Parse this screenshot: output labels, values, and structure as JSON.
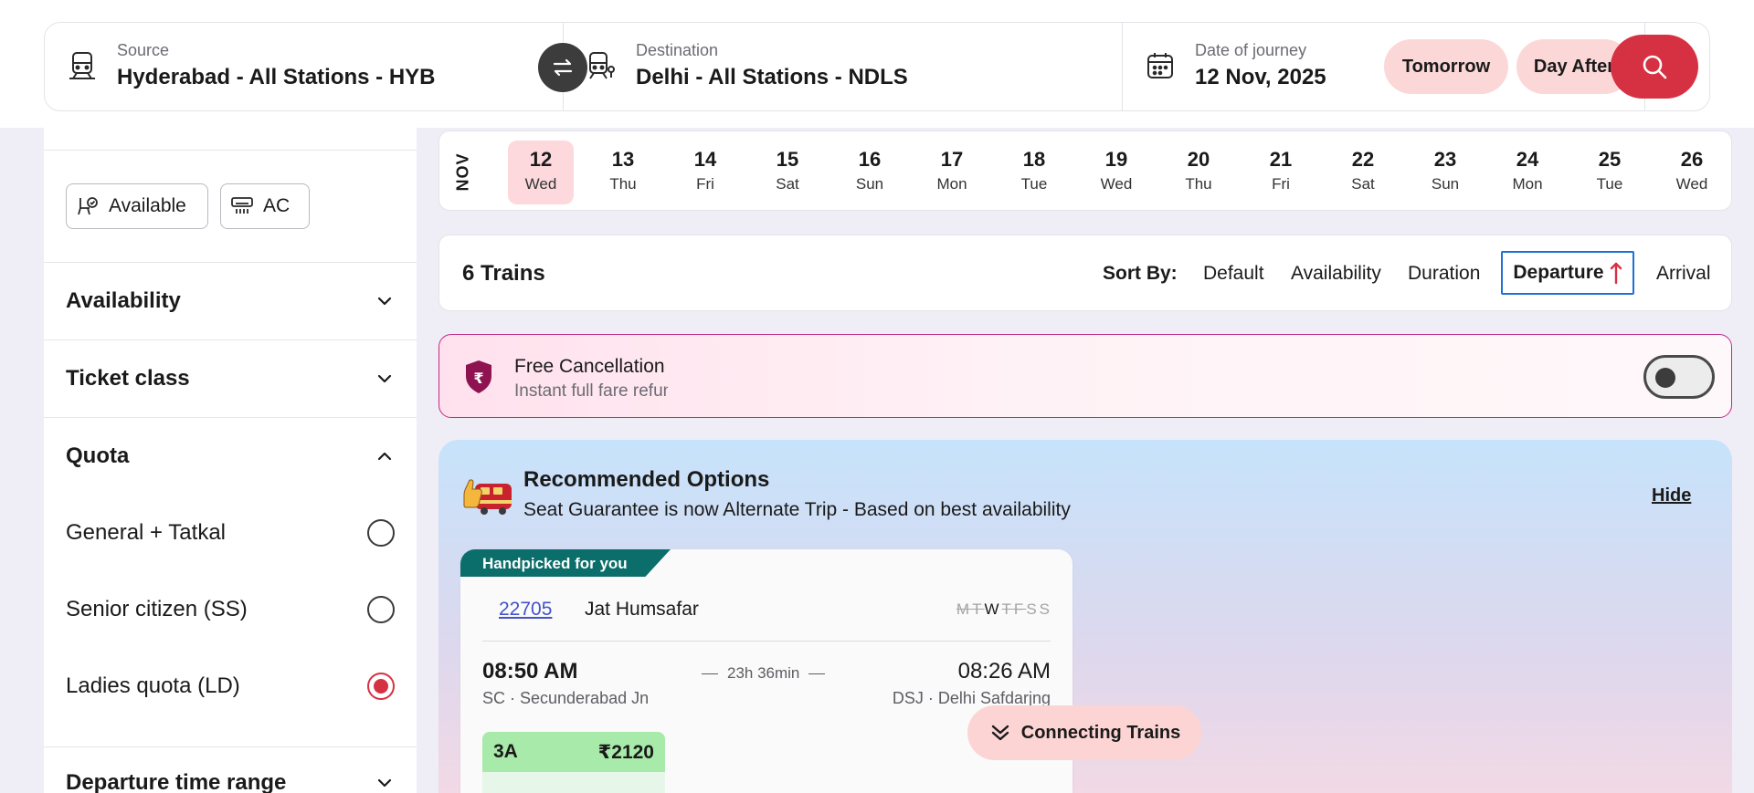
{
  "search": {
    "source_label": "Source",
    "source_value": "Hyderabad - All Stations - HYB",
    "destination_label": "Destination",
    "destination_value": "Delhi - All Stations - NDLS",
    "date_label": "Date of journey",
    "date_value": "12 Nov, 2025",
    "tomorrow_label": "Tomorrow",
    "day_after_label": "Day After",
    "icons": {
      "source": "train-icon",
      "destination": "train-arrive-icon",
      "swap": "swap-icon",
      "date": "calendar-icon",
      "search": "search-icon"
    },
    "accent_color": "#d63142"
  },
  "filters": {
    "quick": [
      {
        "label": "Available",
        "icon": "seat-check-icon"
      },
      {
        "label": "AC",
        "icon": "ac-icon"
      }
    ],
    "sections": {
      "availability": "Availability",
      "ticket_class": "Ticket class",
      "quota": "Quota",
      "departure_time": "Departure time range"
    },
    "quota_options": [
      {
        "label": "General + Tatkal",
        "selected": false
      },
      {
        "label": "Senior citizen (SS)",
        "selected": false
      },
      {
        "label": "Ladies quota (LD)",
        "selected": true
      }
    ]
  },
  "date_strip": {
    "month": "NOV",
    "days": [
      {
        "num": "12",
        "dow": "Wed",
        "selected": true
      },
      {
        "num": "13",
        "dow": "Thu"
      },
      {
        "num": "14",
        "dow": "Fri"
      },
      {
        "num": "15",
        "dow": "Sat"
      },
      {
        "num": "16",
        "dow": "Sun"
      },
      {
        "num": "17",
        "dow": "Mon"
      },
      {
        "num": "18",
        "dow": "Tue"
      },
      {
        "num": "19",
        "dow": "Wed"
      },
      {
        "num": "20",
        "dow": "Thu"
      },
      {
        "num": "21",
        "dow": "Fri"
      },
      {
        "num": "22",
        "dow": "Sat"
      },
      {
        "num": "23",
        "dow": "Sun"
      },
      {
        "num": "24",
        "dow": "Mon"
      },
      {
        "num": "25",
        "dow": "Tue"
      },
      {
        "num": "26",
        "dow": "Wed"
      }
    ]
  },
  "results": {
    "count_label": "6 Trains",
    "sort_label": "Sort By:",
    "sort_options": {
      "default": "Default",
      "availability": "Availability",
      "duration": "Duration",
      "departure": "Departure",
      "arrival": "Arrival"
    },
    "active_sort": "departure"
  },
  "free_cancellation": {
    "title": "Free Cancellation",
    "subtitle": "Instant full fare refund",
    "enabled": false,
    "icon": "rupee-shield-icon"
  },
  "recommended": {
    "title": "Recommended Options",
    "subtitle": "Seat Guarantee is now Alternate Trip - Based on best availability",
    "hide_label": "Hide",
    "card": {
      "tag": "Handpicked for you",
      "train_number": "22705",
      "train_name": "Jat Humsafar",
      "run_days": [
        {
          "d": "M",
          "runs": false
        },
        {
          "d": "T",
          "runs": false
        },
        {
          "d": "W",
          "runs": true
        },
        {
          "d": "T",
          "runs": false
        },
        {
          "d": "F",
          "runs": false
        },
        {
          "d": "S",
          "runs": false
        },
        {
          "d": "S",
          "runs": false
        }
      ],
      "departure_time": "08:50 AM",
      "arrival_time": "08:26 AM",
      "duration": "23h 36min",
      "from_station": "SC · Secunderabad Jn",
      "to_station": "DSJ · Delhi Safdarjng",
      "class_code": "3A",
      "class_fare": "₹2120"
    }
  },
  "connecting_trains_label": "Connecting Trains"
}
